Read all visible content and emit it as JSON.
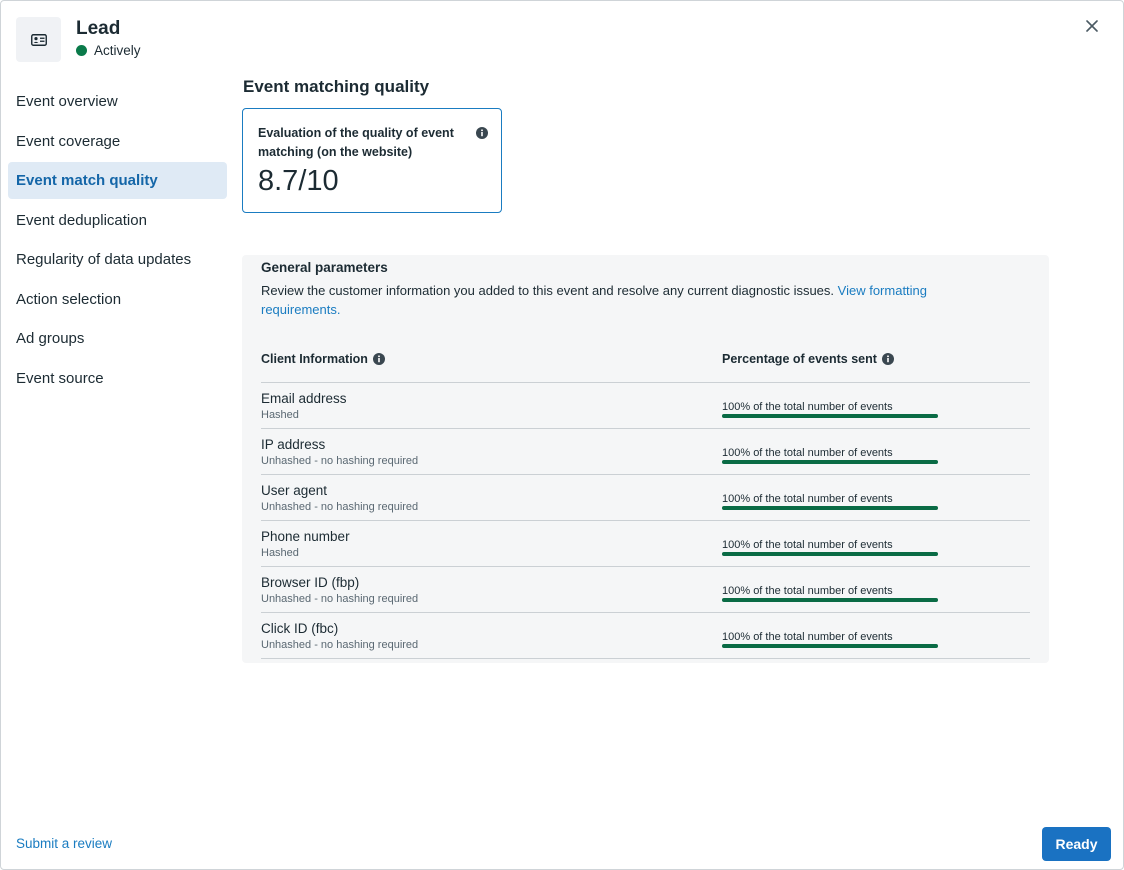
{
  "header": {
    "title": "Lead",
    "status": "Actively",
    "status_color": "#0a7a4a",
    "icon": "id-card-icon"
  },
  "sidebar": {
    "items": [
      {
        "label": "Event overview",
        "active": false
      },
      {
        "label": "Event coverage",
        "active": false
      },
      {
        "label": "Event match quality",
        "active": true
      },
      {
        "label": "Event deduplication",
        "active": false
      },
      {
        "label": "Regularity of data updates",
        "active": false
      },
      {
        "label": "Action selection",
        "active": false
      },
      {
        "label": "Ad groups",
        "active": false
      },
      {
        "label": "Event source",
        "active": false
      }
    ]
  },
  "main": {
    "title": "Event matching quality",
    "score_card": {
      "label": "Evaluation of the quality of event matching (on the website)",
      "value": "8.7/10"
    },
    "params": {
      "title": "General parameters",
      "description": "Review the customer information you added to this event and resolve any current diagnostic issues.",
      "link": "View formatting requirements.",
      "col_client": "Client Information",
      "col_percent": "Percentage of events sent",
      "rows": [
        {
          "name": "Email address",
          "sub": "Hashed",
          "pct": "100% of the total number of events",
          "fill": 1.0
        },
        {
          "name": "IP address",
          "sub": "Unhashed - no hashing required",
          "pct": "100% of the total number of events",
          "fill": 1.0
        },
        {
          "name": "User agent",
          "sub": "Unhashed - no hashing required",
          "pct": "100% of the total number of events",
          "fill": 1.0
        },
        {
          "name": "Phone number",
          "sub": "Hashed",
          "pct": "100% of the total number of events",
          "fill": 1.0
        },
        {
          "name": "Browser ID (fbp)",
          "sub": "Unhashed - no hashing required",
          "pct": "100% of the total number of events",
          "fill": 1.0
        },
        {
          "name": "Click ID (fbc)",
          "sub": "Unhashed - no hashing required",
          "pct": "100% of the total number of events",
          "fill": 1.0
        }
      ]
    }
  },
  "footer": {
    "submit_review": "Submit a review",
    "ready": "Ready"
  },
  "colors": {
    "accent": "#1a72c2",
    "bar_fill": "#0a6b45",
    "active_nav_bg": "#dfeaf5"
  }
}
